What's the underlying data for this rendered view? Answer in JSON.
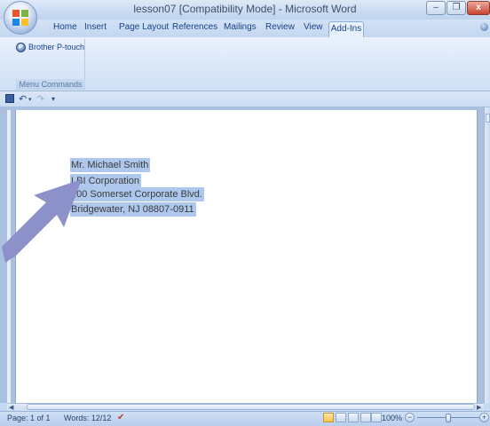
{
  "window": {
    "title": "lesson07 [Compatibility Mode] - Microsoft Word",
    "minimize_label": "–",
    "restore_label": "❐",
    "close_label": "x"
  },
  "ribbon": {
    "tabs": [
      "Home",
      "Insert",
      "Page Layout",
      "References",
      "Mailings",
      "Review",
      "View",
      "Add-Ins"
    ],
    "active_tab": "Add-Ins",
    "group_button_label": "Brother P-touch",
    "group_label": "Menu Commands"
  },
  "document": {
    "address_lines": [
      "Mr. Michael Smith",
      "LBI Corporation",
      "100 Somerset Corporate Blvd.",
      "Bridgewater, NJ   08807-0911"
    ]
  },
  "status": {
    "page": "Page: 1 of 1",
    "words": "Words: 12/12",
    "zoom": "100%"
  },
  "colors": {
    "selection": "#aec7ec",
    "arrow": "#8c92c9",
    "ribbon": "#d9e6f8"
  }
}
